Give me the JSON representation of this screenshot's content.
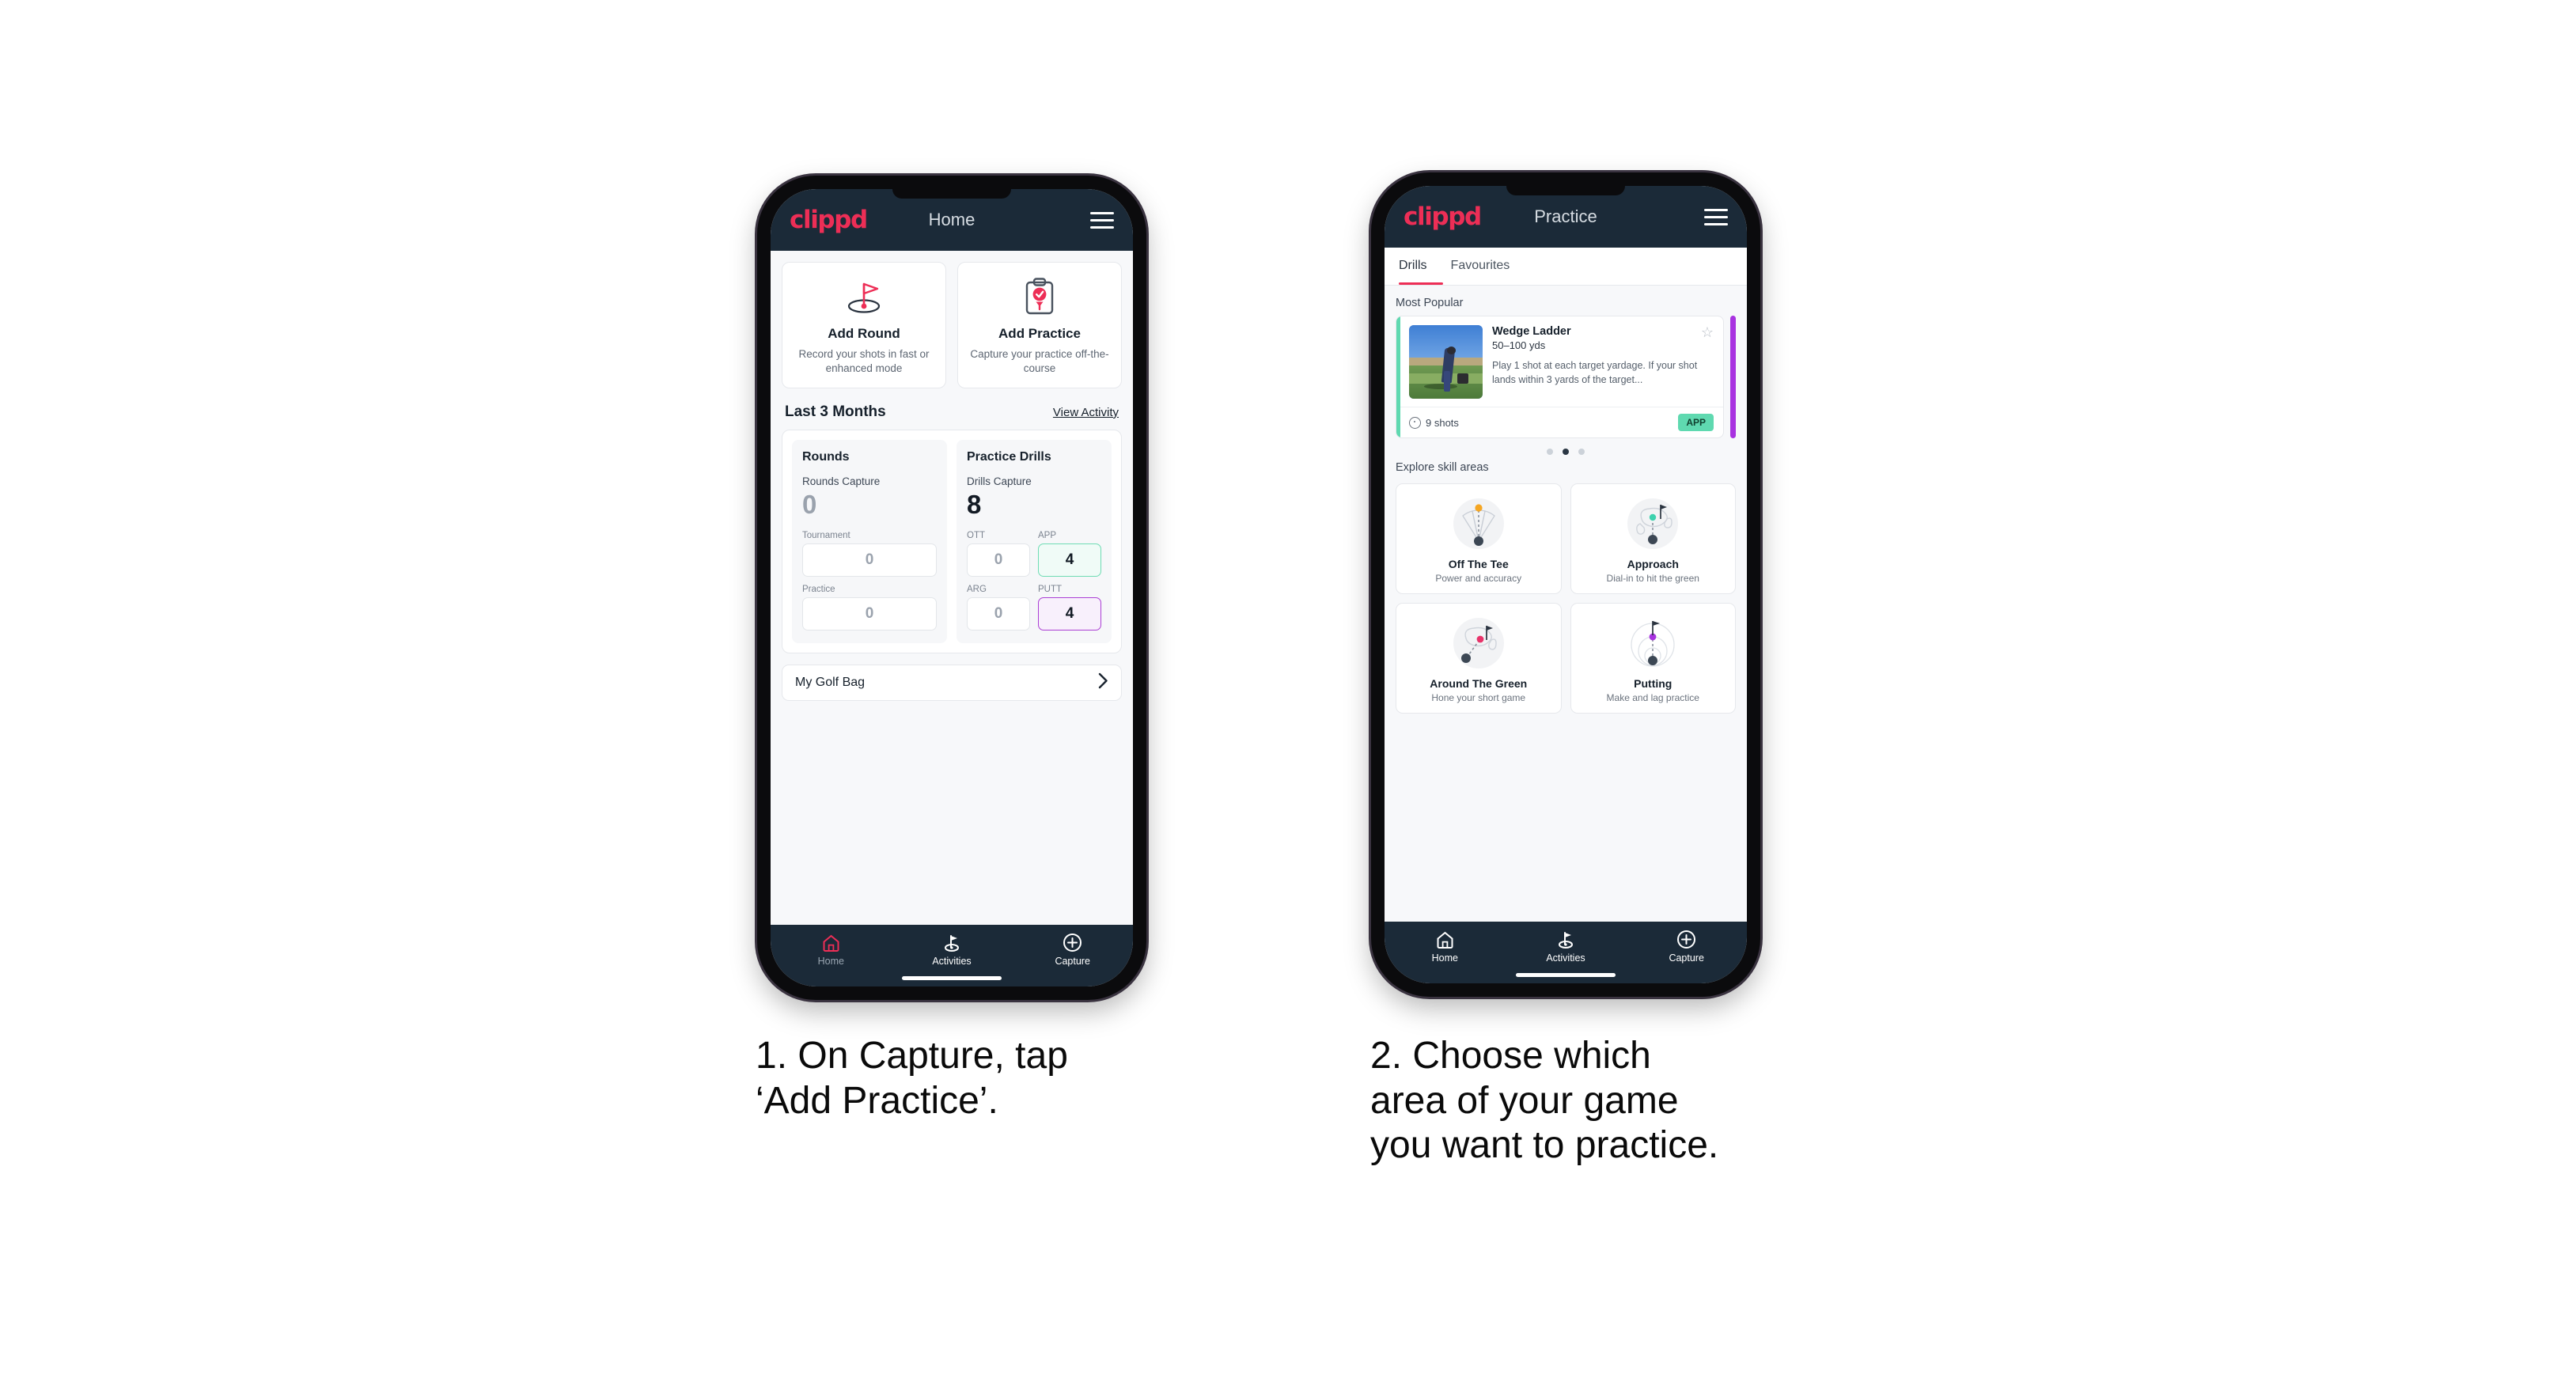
{
  "phone1": {
    "header": {
      "logo": "clippd",
      "title": "Home",
      "menu_icon": "hamburger-icon"
    },
    "actions": [
      {
        "icon": "golf-flag-icon",
        "title": "Add Round",
        "desc": "Record your shots in fast or enhanced mode"
      },
      {
        "icon": "clipboard-check-icon",
        "title": "Add Practice",
        "desc": "Capture your practice off-the-course"
      }
    ],
    "section": {
      "title": "Last 3 Months",
      "link": "View Activity"
    },
    "stats": {
      "rounds": {
        "heading": "Rounds",
        "capture_label": "Rounds Capture",
        "capture_value": "0",
        "items": [
          {
            "label": "Tournament",
            "value": "0"
          },
          {
            "label": "Practice",
            "value": "0"
          }
        ]
      },
      "drills": {
        "heading": "Practice Drills",
        "capture_label": "Drills Capture",
        "capture_value": "8",
        "items": [
          {
            "label": "OTT",
            "value": "0"
          },
          {
            "label": "APP",
            "value": "4"
          },
          {
            "label": "ARG",
            "value": "0"
          },
          {
            "label": "PUTT",
            "value": "4"
          }
        ]
      }
    },
    "golf_bag": {
      "label": "My Golf Bag",
      "chevron": "chevron-right-icon"
    },
    "nav": [
      {
        "icon": "home-icon",
        "label": "Home",
        "active": true
      },
      {
        "icon": "golf-flag-icon",
        "label": "Activities",
        "active": false
      },
      {
        "icon": "plus-circle-icon",
        "label": "Capture",
        "active": false
      }
    ]
  },
  "phone2": {
    "header": {
      "logo": "clippd",
      "title": "Practice",
      "menu_icon": "hamburger-icon"
    },
    "tabs": [
      {
        "label": "Drills",
        "active": true
      },
      {
        "label": "Favourites",
        "active": false
      }
    ],
    "most_popular_label": "Most Popular",
    "drill": {
      "title": "Wedge Ladder",
      "yardage": "50–100 yds",
      "desc": "Play 1 shot at each target yardage. If your shot lands within 3 yards of the target...",
      "shots": "9 shots",
      "badge": "APP",
      "star_icon": "star-outline-icon",
      "accent_color": "#5fd9b0",
      "next_accent_color": "#a832e0"
    },
    "carousel": {
      "count": 3,
      "active_index": 1
    },
    "explore_label": "Explore skill areas",
    "skills": [
      {
        "icon": "off-the-tee-icon",
        "title": "Off The Tee",
        "desc": "Power and accuracy",
        "dot_color": "#f5a623"
      },
      {
        "icon": "approach-icon",
        "title": "Approach",
        "desc": "Dial-in to hit the green",
        "dot_color": "#3ed2ae"
      },
      {
        "icon": "around-the-green-icon",
        "title": "Around The Green",
        "desc": "Hone your short game",
        "dot_color": "#e8336a"
      },
      {
        "icon": "putting-icon",
        "title": "Putting",
        "desc": "Make and lag practice",
        "dot_color": "#a832e0"
      }
    ],
    "nav": [
      {
        "icon": "home-icon",
        "label": "Home",
        "active": false
      },
      {
        "icon": "golf-flag-icon",
        "label": "Activities",
        "active": false
      },
      {
        "icon": "plus-circle-icon",
        "label": "Capture",
        "active": false
      }
    ]
  },
  "captions": {
    "step1": "1. On Capture, tap\n‘Add Practice’.",
    "step2": "2. Choose which\narea of your game\nyou want to practice."
  },
  "colors": {
    "brand_pink": "#ed2e56",
    "header_navy": "#1b2a38",
    "mint": "#5fd9b0",
    "purple": "#a832e0"
  }
}
